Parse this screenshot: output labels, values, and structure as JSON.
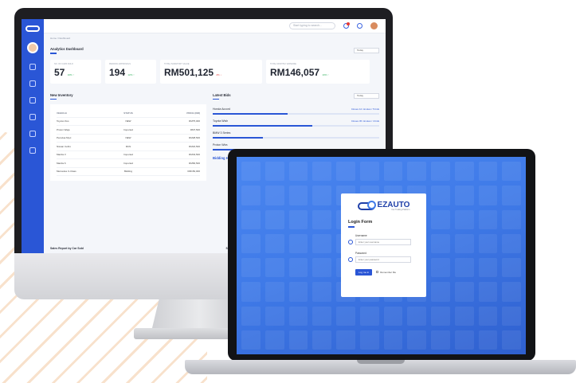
{
  "colors": {
    "brand_blue": "#2a56d6",
    "laptop_bg": "#3f7ae8",
    "positive": "#2fae5b",
    "negative": "#e53935"
  },
  "dashboard": {
    "search_placeholder": "Start typing to search...",
    "breadcrumb": "Home / Dashboard",
    "title": "Analytics Dashboard",
    "period_select": "Today",
    "stats": [
      {
        "label": "NO. OF CARS SOLD",
        "value": "57",
        "change": "10% ↑",
        "trend": "up"
      },
      {
        "label": "PENDING APPROVALS",
        "value": "194",
        "change": "12% ↑",
        "trend": "up"
      },
      {
        "label": "TOTAL INVENTORY VALUE",
        "value": "RM501,125",
        "change": "2% ↓",
        "trend": "down"
      },
      {
        "label": "TOTAL MONTHLY EXPENSE",
        "value": "RM146,057",
        "change": "10% ↑",
        "trend": "up"
      }
    ],
    "new_inventory": {
      "title": "New Inventory",
      "columns": [
        "VEHICLE",
        "STATUS",
        "PRICE (RM)"
      ],
      "rows": [
        [
          "Toyota Vios",
          "NEW",
          "RM75,000"
        ],
        [
          "Proton Waja",
          "Imported",
          "RM7,500"
        ],
        [
          "Perodua Myvi",
          "NEW",
          "RM28,500"
        ],
        [
          "Nissan Cefiro",
          "RCN",
          "RM22,500"
        ],
        [
          "Mazda 3",
          "Imported",
          "RM43,500"
        ],
        [
          "Mazda 6",
          "Imported",
          "RM66,500"
        ],
        [
          "Mercedes C-Class",
          "Bidding",
          "RM150,000"
        ]
      ]
    },
    "latest_bids": {
      "title": "Latest Bids",
      "select": "Today",
      "items": [
        {
          "name": "Honda Accord",
          "link": "Closes 12 minutes / 5 bids",
          "progress": 0.45
        },
        {
          "name": "Toyota Wish",
          "link": "Closes 45 minutes / 4 bids",
          "progress": 0.6
        },
        {
          "name": "BMW 3 Series",
          "link": "",
          "progress": 0.3
        },
        {
          "name": "Proton Wira",
          "link": "",
          "progress": 0.2
        }
      ],
      "chart_label": "Bidding Hist"
    },
    "footer_left": "Sales Report by Car Sold",
    "footer_right": "Sales Report by"
  },
  "login": {
    "brand_name": "EZAUTO",
    "brand_tagline": "Car Trading Platform",
    "title": "Login Form",
    "username_label": "Username",
    "username_placeholder": "Enter your username",
    "password_label": "Password",
    "password_placeholder": "Enter your password",
    "login_button": "Log me in",
    "remember_label": "Remember Me"
  }
}
